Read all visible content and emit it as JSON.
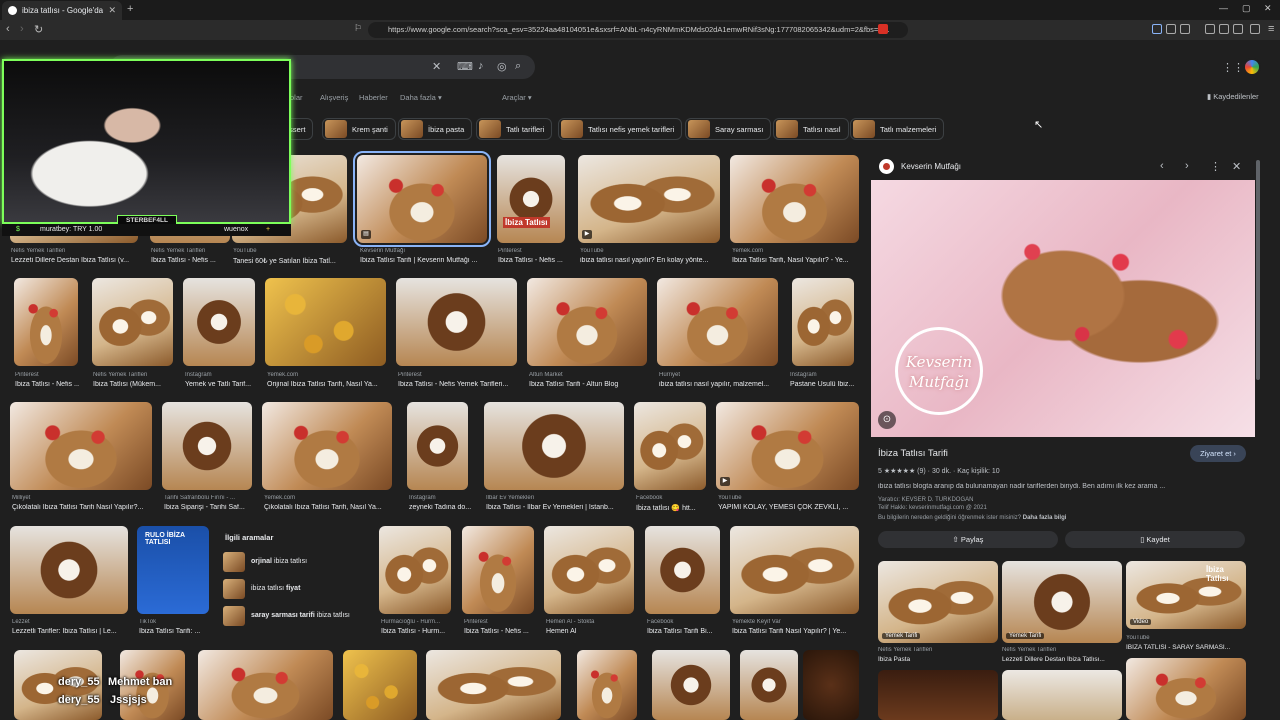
{
  "browser": {
    "tab_title": "ibiza tatlısı - Google'da Ara",
    "url": "https://www.google.com/search?sca_esv=35224aa48104051e&sxsrf=ANbL-n4cyRNMmKDMds02dA1emwRNif3sNg:1777082065342&udm=2&fbs=A..."
  },
  "google": {
    "nav": {
      "haberler": "Haberler",
      "videolar": "olar",
      "alisveris": "Alışveriş",
      "daha_fazla": "Daha fazla",
      "araclar": "Araçlar",
      "kaydedilenler": "Kaydedilenler"
    },
    "chips": [
      "essert",
      "Krem şanti",
      "İbiza pasta",
      "Tatlı tarifleri",
      "Tatlısı nefis yemek tarifleri",
      "Saray sarması",
      "Tatlısı nasıl",
      "Tatlı malzemeleri"
    ]
  },
  "rows": {
    "r1": [
      {
        "src": "Nefis Yemek Tarifleri",
        "cap": "Lezzeti Dillere Destan İbiza Tatlısı (v..."
      },
      {
        "src": "Nefis Yemek Tarifleri",
        "cap": "İbiza Tatlısı - Nefis ..."
      },
      {
        "src": "YouTube",
        "cap": "Tanesi 60₺ ye Satılan İbiza Tatl..."
      },
      {
        "src": "Kevserin Mutfağı",
        "cap": "İbiza Tatlısı Tarifi | Kevserin Mutfağı ..."
      },
      {
        "src": "Pinterest",
        "cap": "İbiza Tatlısı - Nefis ..."
      },
      {
        "src": "YouTube",
        "cap": "ibiza tatlısı nasıl yapılır? En kolay yönte..."
      },
      {
        "src": "Yemek.com",
        "cap": "İbiza Tatlısı Tarifi, Nasıl Yapılır? - Ye..."
      }
    ],
    "r2": [
      {
        "src": "Pinterest",
        "cap": "İbiza Tatlısı - Nefis ..."
      },
      {
        "src": "Nefis Yemek Tarifleri",
        "cap": "İbiza Tatlısı (Mükem..."
      },
      {
        "src": "Instagram",
        "cap": "Yemek ve Tatlı Tarif..."
      },
      {
        "src": "Yemek.com",
        "cap": "Orijinal İbiza Tatlısı Tarifi, Nasıl Ya..."
      },
      {
        "src": "Pinterest",
        "cap": "İbiza Tatlısı - Nefis Yemek Tarifleri..."
      },
      {
        "src": "Altun Market",
        "cap": "İbiza Tatlısı Tarifi - Altun Blog"
      },
      {
        "src": "Hürriyet",
        "cap": "ibiza tatlısı nasıl yapılır, malzemel..."
      },
      {
        "src": "Instagram",
        "cap": "Pastane Usulü İbiz..."
      }
    ],
    "r3": [
      {
        "src": "Milliyet",
        "cap": "Çikolatalı İbiza Tatlısı Tarifi Nasıl Yapılır?..."
      },
      {
        "src": "Tarihi Safranbolu Fırını - ...",
        "cap": "İbiza Siparişi - Tarihi Saf..."
      },
      {
        "src": "Yemek.com",
        "cap": "Çikolatalı İbiza Tatlısı Tarifi, Nasıl Ya..."
      },
      {
        "src": "Instagram",
        "cap": "zeyneki Tadına do..."
      },
      {
        "src": "İlbar Ev Yemekleri",
        "cap": "İbiza Tatlısı - İlbar Ev Yemekleri | İstanb..."
      },
      {
        "src": "Facebook",
        "cap": "İbiza tatlısı 😋 htt..."
      },
      {
        "src": "YouTube",
        "cap": "YAPIMI KOLAY, YEMESİ ÇOK ZEVKLİ, ..."
      }
    ],
    "r4": [
      {
        "src": "Lezzet",
        "cap": "Lezzetli Tarifler: İbiza Tatlısı | Le..."
      },
      {
        "src": "TikTok",
        "cap": "İbiza Tatlısı Tarifi: ..."
      },
      {
        "src": "Hurmacıoğlu - Hurm...",
        "cap": "İbiza Tatlısı - Hurm..."
      },
      {
        "src": "Pinterest",
        "cap": "İbiza Tatlısı - Nefis ..."
      },
      {
        "src": "Hemen Al - Stokta",
        "cap": "Hemen Al"
      },
      {
        "src": "Facebook",
        "cap": "İbiza Tatlısı Tarifi Bi..."
      },
      {
        "src": "Yemekte Keyif Var",
        "cap": "İbiza Tatlısı Tarifi Nasıl Yapılır? | Ye..."
      }
    ]
  },
  "related": {
    "title": "İlgili aramalar",
    "items": [
      {
        "bold": "orjinal",
        "rest": " ibiza tatlısı"
      },
      {
        "bold": "",
        "pre": "ibiza tatlısı ",
        "boldend": "fiyat"
      },
      {
        "bold": "saray sarması tarifi",
        "rest": " ibiza tatlısı"
      }
    ]
  },
  "overlay_text": {
    "ibiza": "İbiza Tatlısı",
    "rulo": "RULO İBİZA TATLISI",
    "kevserin_wm": "Kevserin Mutfağı",
    "izle": "İbiza Tatlısı"
  },
  "stream": {
    "name": "STERBEF4LL",
    "donor": "muratbey: TRY 1.00",
    "viewer": "wuenox",
    "chat1": "dery_55",
    "chat2": "Mehmet ban",
    "chat3": "dery_55",
    "chat4": "Jssjsjs"
  },
  "detail": {
    "source": "Kevserin Mutfağı",
    "title": "İbiza Tatlısı Tarifi",
    "visit": "Ziyaret et",
    "rating": "5 ★★★★★ (9)",
    "duration": "30 dk.",
    "servings": "Kaç kişilik: 10",
    "desc": "ibiza tatlısı blogta aranıp da bulunamayan nadir tariflerden biriydi. Ben adımı ilk kez arama ...",
    "author": "Yaratıcı: KEVSER D. TURKDOGAN",
    "copyright": "Telif Hakkı: kevserinmutfagi.com @ 2021",
    "learn_q": "Bu bilgilerin nereden geldiğini öğrenmek ister misiniz?",
    "learn_link": "Daha fazla bilgi",
    "share": "Paylaş",
    "save": "Kaydet",
    "thumbs": [
      {
        "src": "Nefis Yemek Tarifleri",
        "cap": "İbiza Pasta",
        "tag": "Yemek Tarifi"
      },
      {
        "src": "Nefis Yemek Tarifleri",
        "cap": "Lezzeti Dillere Destan İbiza Tatlısı...",
        "tag": "Yemek Tarifi"
      },
      {
        "src": "YouTube",
        "cap": "İBİZA TATLISI - SARAY SARMASI...",
        "tag": "Video"
      }
    ]
  },
  "colors": {
    "accent": "#8ab4f8",
    "stream_border": "#7dff5a",
    "visit_bg": "#394457"
  }
}
